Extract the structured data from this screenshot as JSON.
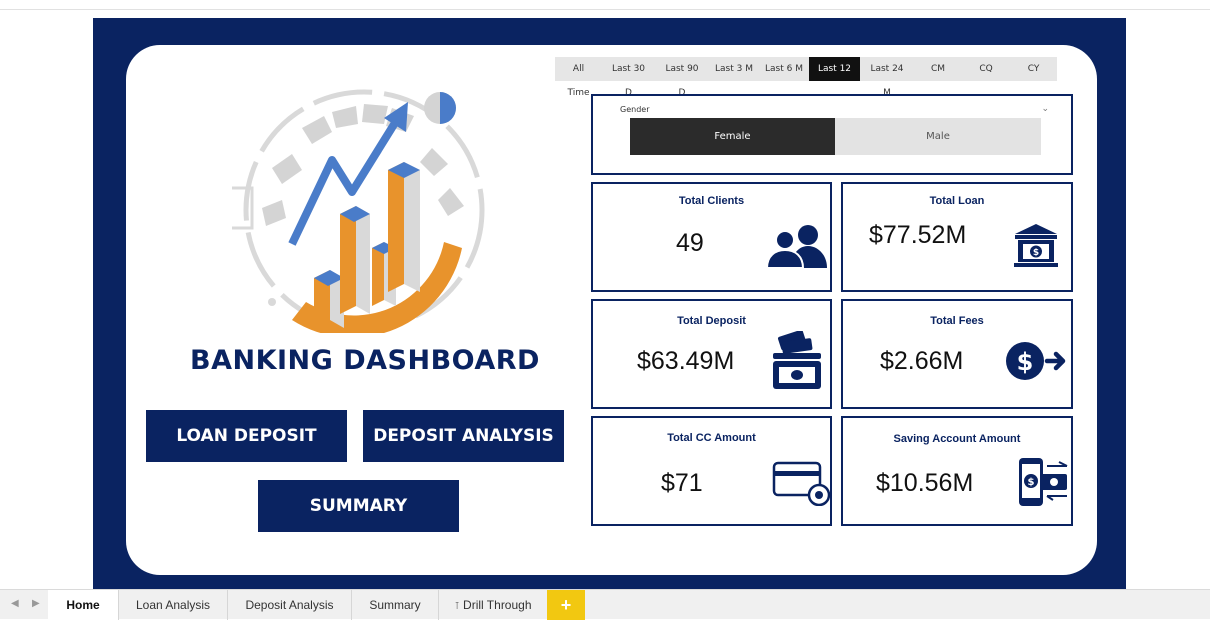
{
  "app": {
    "title": "BANKING DASHBOARD"
  },
  "date_filter": {
    "options": [
      "All Time",
      "Last 30 D",
      "Last 90 D",
      "Last 3 M",
      "Last 6 M",
      "Last 12 M",
      "Last 24 M",
      "CM",
      "CQ",
      "CY"
    ],
    "selected": "Last 12 M"
  },
  "gender_slicer": {
    "title": "Gender",
    "options": [
      "Female",
      "Male"
    ],
    "selected": "Female"
  },
  "kpis": [
    {
      "title": "Total Clients",
      "value": "49",
      "icon": "clients-icon"
    },
    {
      "title": "Total Loan",
      "value": "$77.52M",
      "icon": "bank-icon"
    },
    {
      "title": "Total Deposit",
      "value": "$63.49M",
      "icon": "cash-deposit-icon"
    },
    {
      "title": "Total Fees",
      "value": "$2.66M",
      "icon": "dollar-arrow-icon"
    },
    {
      "title": "Total CC Amount",
      "value": "$71",
      "icon": "credit-card-icon"
    },
    {
      "title": "Saving Account Amount",
      "value": "$10.56M",
      "icon": "mobile-payment-icon"
    }
  ],
  "nav_buttons": {
    "loan_deposit": "LOAN DEPOSIT",
    "deposit_analysis": "DEPOSIT ANALYSIS",
    "summary": "SUMMARY"
  },
  "tabs": [
    {
      "label": "Home",
      "active": true
    },
    {
      "label": "Loan Analysis"
    },
    {
      "label": "Deposit Analysis"
    },
    {
      "label": "Summary"
    },
    {
      "label": "Drill Through",
      "icon": "hidden-page-icon"
    }
  ],
  "add_page_label": "+",
  "colors": {
    "navy": "#0a2361",
    "orange": "#e8932c",
    "blue": "#4a7cc9",
    "accent_yellow": "#f2c811"
  }
}
